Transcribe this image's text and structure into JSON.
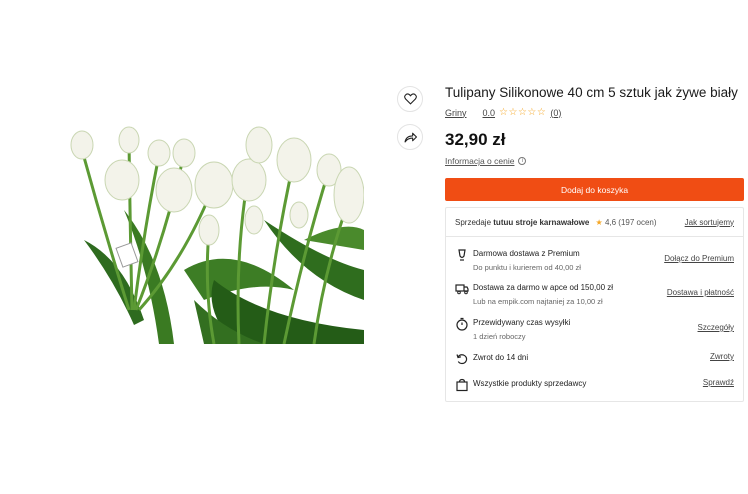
{
  "product": {
    "title": "Tulipany Silikonowe 40 cm 5 sztuk jak żywe biały",
    "brand": "Griny",
    "rating": "0.0",
    "stars": "☆☆☆☆☆",
    "review_count": "(0)",
    "price": "32,90 zł",
    "price_info": "Informacja o cenie",
    "cart_button": "Dodaj do koszyka"
  },
  "actions": {
    "favorite_icon": "heart-icon",
    "share_icon": "share-icon"
  },
  "seller": {
    "prefix": "Sprzedaje",
    "name": "tutuu stroje karnawałowe",
    "rating": "4,6",
    "rating_count": "(197 ocen)",
    "link": "Jak sortujemy"
  },
  "features": [
    {
      "icon": "premium-icon",
      "title": "Darmowa dostawa z Premium",
      "subtitle": "Do punktu i kurierem od 40,00 zł",
      "link": "Dołącz do Premium"
    },
    {
      "icon": "truck-icon",
      "title": "Dostawa za darmo w apce od 150,00 zł",
      "subtitle": "Lub na empik.com najtaniej za 10,00 zł",
      "link": "Dostawa i płatność"
    },
    {
      "icon": "timer-icon",
      "title": "Przewidywany czas wysyłki",
      "subtitle": "1 dzień roboczy",
      "link": "Szczegóły"
    },
    {
      "icon": "return-icon",
      "title": "Zwrot do 14 dni",
      "subtitle": "",
      "link": "Zwroty"
    },
    {
      "icon": "bag-icon",
      "title": "Wszystkie produkty sprzedawcy",
      "subtitle": "",
      "link": "Sprawdź"
    }
  ],
  "colors": {
    "accent": "#f04d14",
    "star": "#f5a623",
    "premium": "#2d5bd7"
  }
}
